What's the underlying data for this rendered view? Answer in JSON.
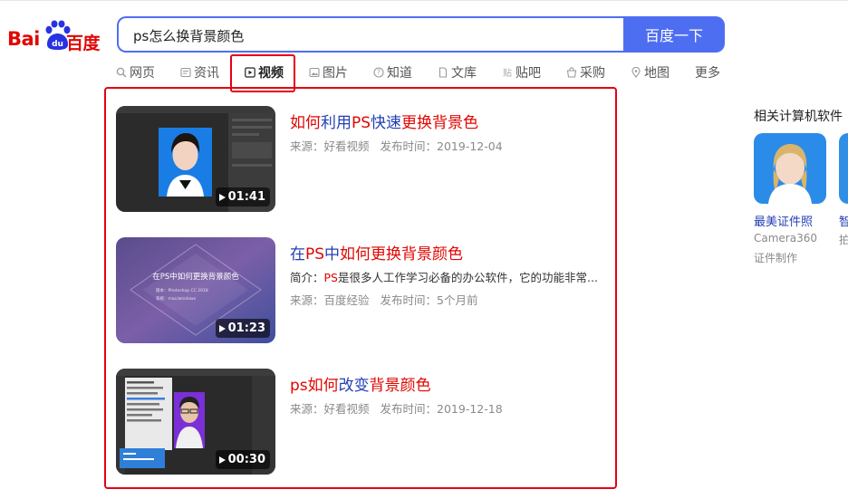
{
  "logo": {
    "left": "Bai",
    "right": "百度",
    "paw_text": "du"
  },
  "search": {
    "query": "ps怎么换背景颜色",
    "button_label": "百度一下"
  },
  "nav": {
    "items": [
      {
        "label": "网页",
        "icon": "search-icon"
      },
      {
        "label": "资讯",
        "icon": "news-icon"
      },
      {
        "label": "视频",
        "icon": "video-icon",
        "active": true
      },
      {
        "label": "图片",
        "icon": "image-icon"
      },
      {
        "label": "知道",
        "icon": "question-icon"
      },
      {
        "label": "文库",
        "icon": "doc-icon"
      },
      {
        "label": "贴吧",
        "icon": "tieba-icon"
      },
      {
        "label": "采购",
        "icon": "shop-icon"
      },
      {
        "label": "地图",
        "icon": "map-icon"
      },
      {
        "label": "更多",
        "icon": ""
      }
    ]
  },
  "results": [
    {
      "title_parts": [
        {
          "text": "如何",
          "color": "red"
        },
        {
          "text": "利用",
          "color": "blue"
        },
        {
          "text": "PS",
          "color": "red"
        },
        {
          "text": "快速",
          "color": "blue"
        },
        {
          "text": "更换背景色",
          "color": "red"
        }
      ],
      "duration": "01:41",
      "source": "来源：好看视频",
      "published": "发布时间：2019-12-04"
    },
    {
      "title_parts": [
        {
          "text": "在",
          "color": "blue"
        },
        {
          "text": "PS",
          "color": "red"
        },
        {
          "text": "中",
          "color": "blue"
        },
        {
          "text": "如何更换背景颜色",
          "color": "red"
        }
      ],
      "duration": "01:23",
      "desc_prefix": "简介：",
      "desc_hl": "PS",
      "desc_rest": "是很多人工作学习必备的办公软件，它的功能非常...",
      "thumb_title": "在PS中如何更换背景颜色",
      "thumb_line1": "版本：Photoshop CC 2018",
      "thumb_line2": "系统：mac/windows",
      "source": "来源：百度经验",
      "published": "发布时间：5个月前"
    },
    {
      "title_parts": [
        {
          "text": "ps如何",
          "color": "red"
        },
        {
          "text": "改变",
          "color": "blue"
        },
        {
          "text": "背景颜色",
          "color": "red"
        }
      ],
      "duration": "00:30",
      "source": "来源：好看视频",
      "published": "发布时间：2019-12-18"
    }
  ],
  "sidebar": {
    "title": "相关计算机软件",
    "apps": [
      {
        "name": "最美证件照",
        "sub1": "Camera360",
        "sub2": "证件制作"
      },
      {
        "name": "智",
        "sub1": "拍",
        "sub2": ""
      }
    ]
  },
  "colors": {
    "brand_red": "#e10601",
    "link_blue": "#2440b3",
    "accent_blue": "#4e6ef2",
    "highlight_red": "#e60012"
  }
}
